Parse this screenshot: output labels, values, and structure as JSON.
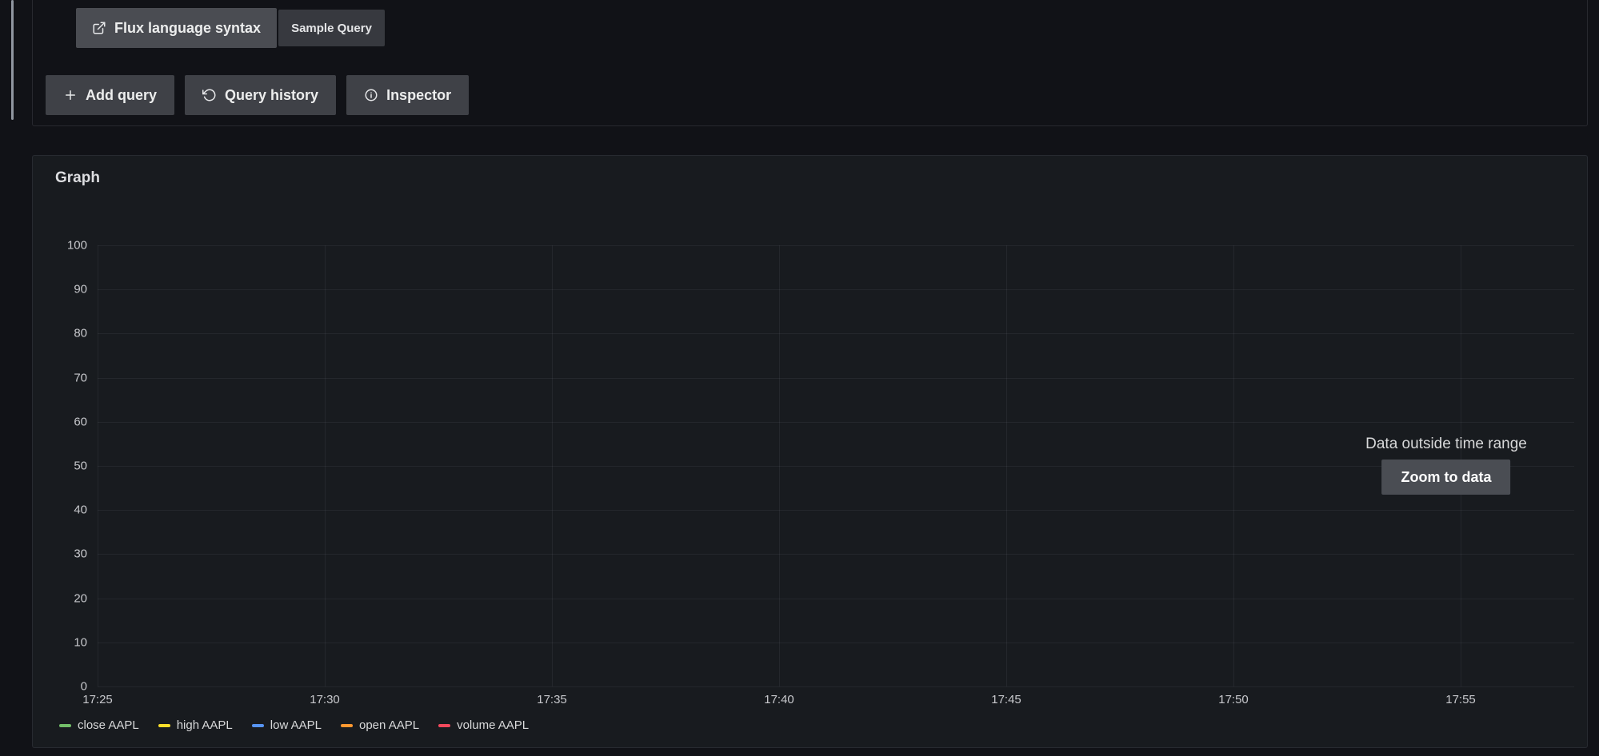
{
  "colors": {
    "page_bg": "#111217",
    "panel_bg": "#181b1f",
    "button_bg": "#4a4c52",
    "grid": "rgba(204,204,220,0.07)"
  },
  "query_editor": {
    "flux_link": {
      "label": "Flux language syntax",
      "icon": "external-link-icon"
    },
    "sample_query": {
      "label": "Sample Query"
    },
    "actions": [
      {
        "label": "Add query",
        "icon": "plus-icon"
      },
      {
        "label": "Query history",
        "icon": "history-icon"
      },
      {
        "label": "Inspector",
        "icon": "info-circle-icon"
      }
    ]
  },
  "panel": {
    "title": "Graph",
    "overlay": {
      "message": "Data outside time range",
      "button_label": "Zoom to data"
    }
  },
  "chart_data": {
    "type": "line",
    "title": "Graph",
    "x_ticks": [
      "17:25",
      "17:30",
      "17:35",
      "17:40",
      "17:45",
      "17:50",
      "17:55"
    ],
    "y_ticks": [
      0,
      10,
      20,
      30,
      40,
      50,
      60,
      70,
      80,
      90,
      100
    ],
    "ylim": [
      0,
      100
    ],
    "grid": true,
    "legend_position": "bottom",
    "series": [
      {
        "name": "close AAPL",
        "color": "#73bf69",
        "values": []
      },
      {
        "name": "high AAPL",
        "color": "#fade2a",
        "values": []
      },
      {
        "name": "low AAPL",
        "color": "#5794f2",
        "values": []
      },
      {
        "name": "open AAPL",
        "color": "#ff9830",
        "values": []
      },
      {
        "name": "volume AAPL",
        "color": "#f2495c",
        "values": []
      }
    ],
    "annotations": [
      "Data outside time range"
    ]
  }
}
